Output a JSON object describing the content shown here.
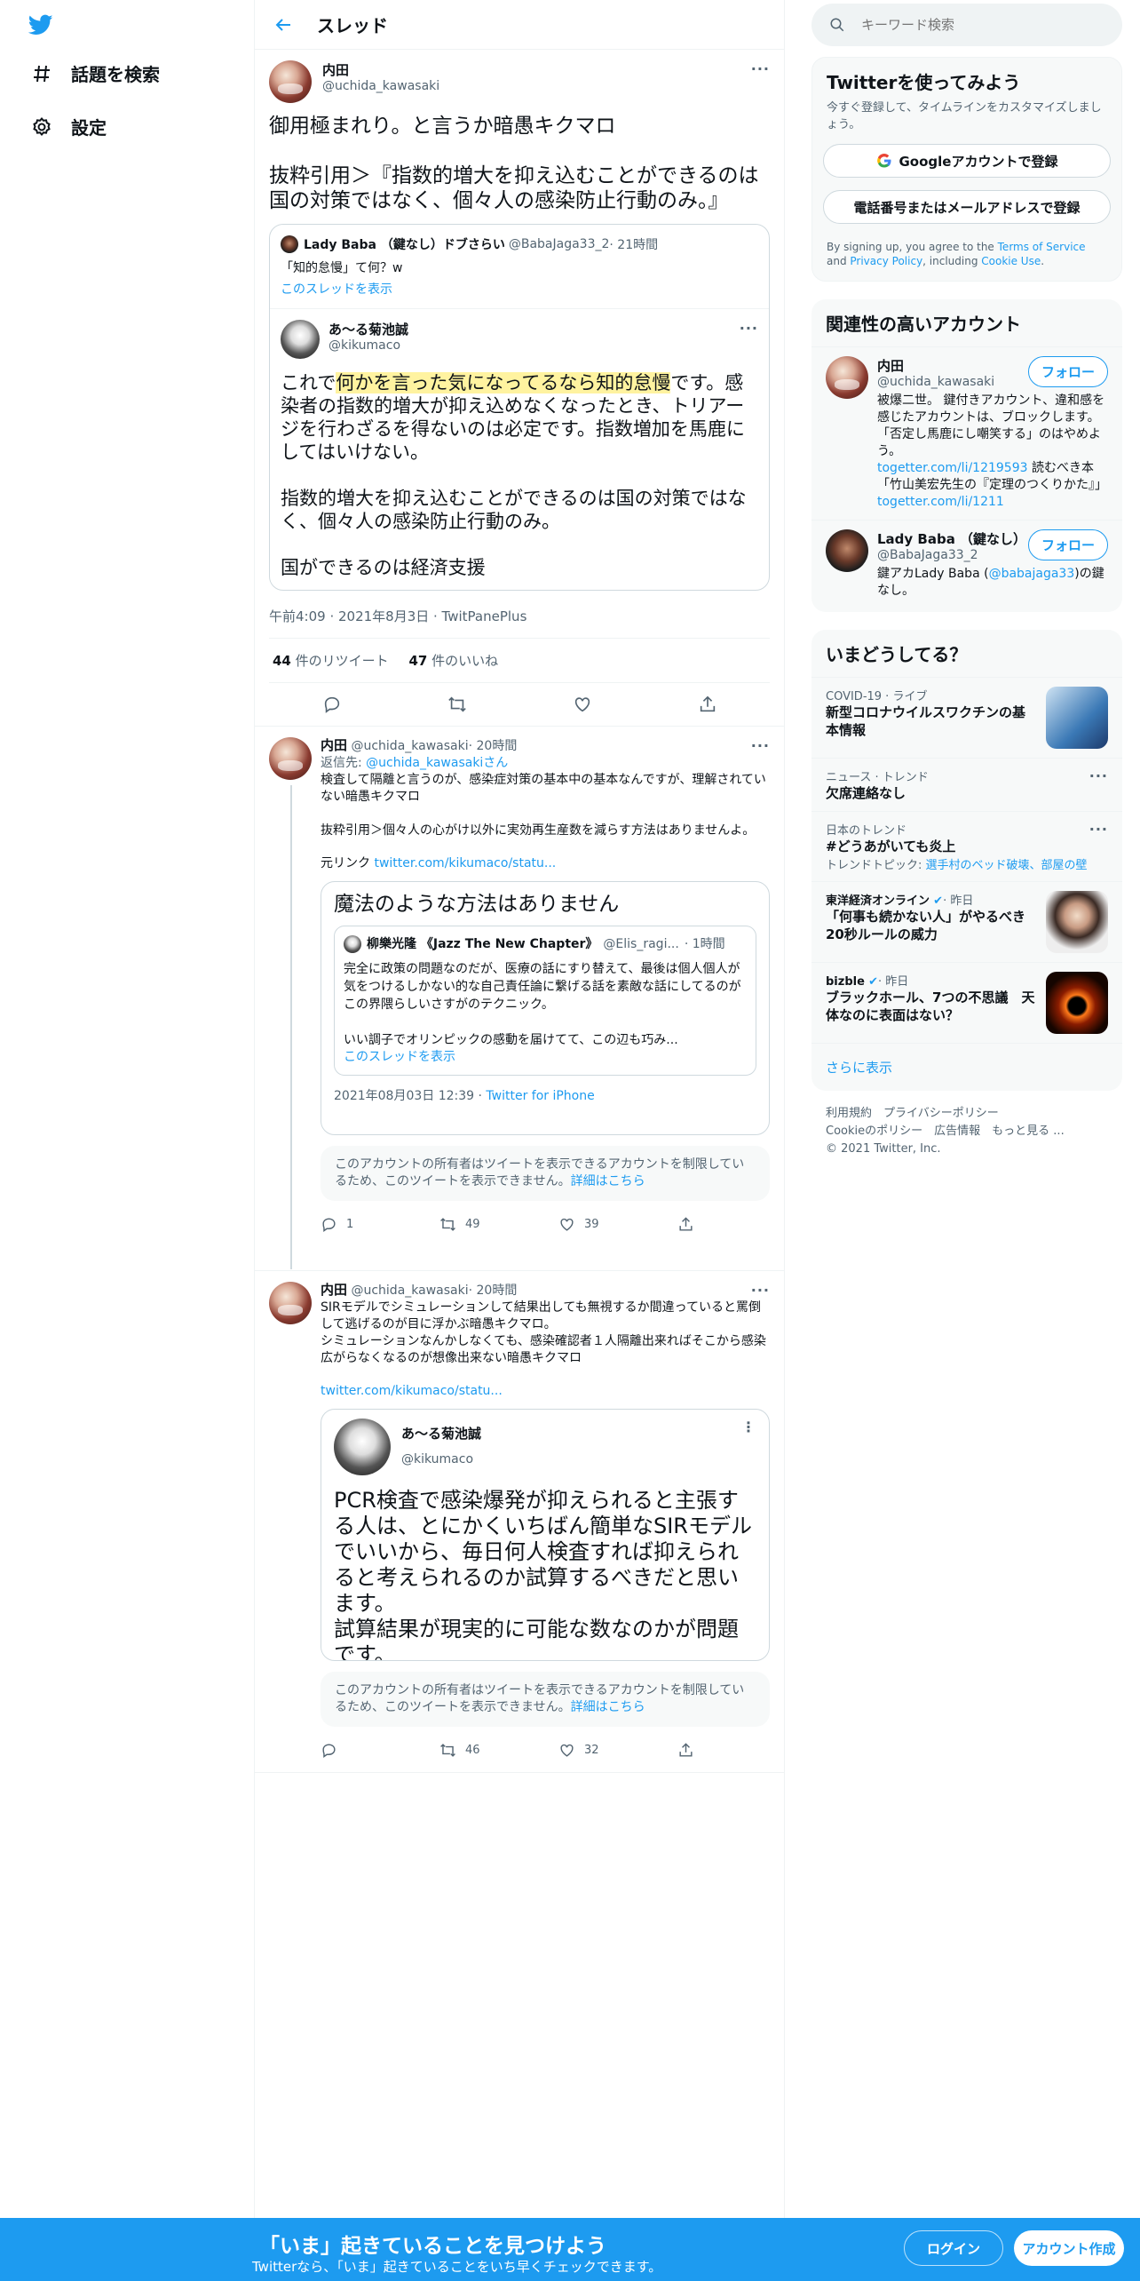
{
  "header": {
    "title": "スレッド"
  },
  "nav": {
    "explore": "話題を検索",
    "settings": "設定"
  },
  "main": {
    "name": "内田",
    "handle": "@uchida_kawasaki",
    "text": "御用極まれり。と言うか暗愚キクマロ\n\n抜粋引用＞『指数的増大を抑え込むことができるのは国の対策ではなく、個々人の感染防止行動のみ。』",
    "quote": {
      "top_name": "Lady Baba （鍵なし）ドブさらい",
      "top_handle": "@BabaJaga33_2",
      "top_time": "· 21時間",
      "top_text": "「知的怠慢」て何？w",
      "top_link": "このスレッドを表示",
      "name": "あ〜る菊池誠",
      "handle": "@kikumaco",
      "text_a": "これで",
      "text_hl": "何かを言った気になってるなら知的怠慢",
      "text_b": "です。感染者の指数的増大が抑え込めなくなったとき、トリアージを行わざるを得ないのは必定です。指数増加を馬鹿にしてはいけない。\n\n指数的増大を抑え込むことができるのは国の対策ではなく、個々人の感染防止行動のみ。\n\n国ができるのは経済支援"
    },
    "meta": "午前4:09 · 2021年8月3日 · TwitPanePlus",
    "retweets": "44",
    "retweets_label": "件のリツイート",
    "likes": "47",
    "likes_label": "件のいいね"
  },
  "reply1": {
    "name": "内田",
    "handle": "@uchida_kawasaki",
    "time": "· 20時間",
    "reply_to_label": "返信先: ",
    "reply_to": "@uchida_kawasakiさん",
    "text": "検査して隔離と言うのが、感染症対策の基本中の基本なんですが、理解されていない暗愚キクマロ\n\n抜粋引用＞個々人の心がけ以外に実効再生産数を減らす方法はありませんよ。",
    "link_label": "元リンク ",
    "link": "twitter.com/kikumaco/statu...",
    "card": {
      "title": "魔法のような方法はありません",
      "q_name": "柳樂光隆 《Jazz The New Chapter》",
      "q_handle": "@Elis_ragi...",
      "q_time": "· 1時間",
      "q_text": "完全に政策の問題なのだが、医療の話にすり替えて、最後は個人個人が気をつけるしかない的な自己責任論に繋げる話を素敵な話にしてるのがこの界隈らしいさすがのテクニック。\n\nいい調子でオリンピックの感動を届けてて、この辺も巧み...",
      "q_link": "このスレッドを表示",
      "date": "2021年08月03日 12:39 · ",
      "source": "Twitter for iPhone"
    },
    "notice": "このアカウントの所有者はツイートを表示できるアカウントを制限しているため、このツイートを表示できません。",
    "notice_link": "詳細はこちら",
    "replies": "1",
    "retweets": "49",
    "likes": "39"
  },
  "reply2": {
    "name": "内田",
    "handle": "@uchida_kawasaki",
    "time": "· 20時間",
    "text": "SIRモデルでシミュレーションして結果出しても無視するか間違っていると罵倒して逃げるのが目に浮かぶ暗愚キクマロ。\nシミュレーションなんかしなくても、感染確認者１人隔離出来ればそこから感染広がらなくなるのが想像出来ない暗愚キクマロ",
    "link": "twitter.com/kikumaco/statu...",
    "quote": {
      "name": "あ〜る菊池誠",
      "handle": "@kikumaco",
      "text": "PCR検査で感染爆発が抑えられると主張する人は、とにかくいちばん簡単なSIRモデルでいいから、毎日何人検査すれば抑えられると考えられるのか試算するべきだと思います。\n試算結果が現実的に可能な数なのかが問題です。\nこればっかりは試算なしに議論できない"
    },
    "notice": "このアカウントの所有者はツイートを表示できるアカウントを制限しているため、このツイートを表示できません。",
    "notice_link": "詳細はこちら",
    "retweets": "46",
    "likes": "32"
  },
  "right": {
    "search_placeholder": "キーワード検索",
    "signup": {
      "title": "Twitterを使ってみよう",
      "sub": "今すぐ登録して、タイムラインをカスタマイズしましょう。",
      "google": "Googleアカウントで登録",
      "phone": "電話番号またはメールアドレスで登録",
      "legal_a": "By signing up, you agree to the ",
      "terms": "Terms of Service",
      "legal_b": " and ",
      "privacy": "Privacy Policy",
      "legal_c": ", including ",
      "cookie": "Cookie Use",
      "legal_d": "."
    },
    "related": {
      "title": "関連性の高いアカウント",
      "follow": "フォロー",
      "a1": {
        "name": "内田",
        "handle": "@uchida_kawasaki",
        "bio_a": "被爆二世。 鍵付きアカウント、違和感を感じたアカウントは、ブロックします。「否定し馬鹿にし嘲笑する」のはやめよう。\n",
        "bio_link1": "togetter.com/li/1219593",
        "bio_b": " 読むべき本「竹山美宏先生の『定理のつくりかた』」 ",
        "bio_link2": "togetter.com/li/1211"
      },
      "a2": {
        "name": "Lady Baba （鍵なし）",
        "handle": "@BabaJaga33_2",
        "bio_a": "鍵アカLady Baba (",
        "bio_link": "@babajaga33",
        "bio_b": ")の鍵なし。"
      }
    },
    "trends": {
      "title": "いまどうしてる？",
      "t1": {
        "cat": "COVID-19 · ライブ",
        "title": "新型コロナウイルスワクチンの基本情報"
      },
      "t2": {
        "cat": "ニュース · トレンド",
        "title": "欠席連絡なし"
      },
      "t3": {
        "cat": "日本のトレンド",
        "title": "#どうあがいても炎上",
        "sub_label": "トレンドトピック: ",
        "sub": "選手村のベッド破壊、部屋の壁"
      },
      "t4": {
        "cat": "東洋経済オンライン",
        "time": "· 昨日",
        "title": "「何事も続かない人」がやるべき20秒ルールの威力"
      },
      "t5": {
        "cat": "bizble",
        "time": "· 昨日",
        "title": "ブラックホール、7つの不思議　天体なのに表面はない？"
      },
      "more": "さらに表示"
    },
    "footer": {
      "l1": "利用規約",
      "l2": "プライバシーポリシー",
      "l3": "Cookieのポリシー",
      "l4": "広告情報",
      "l5": "もっと見る ...",
      "copy": "© 2021 Twitter, Inc."
    }
  },
  "bottom": {
    "title": "「いま」起きていることを見つけよう",
    "sub": "Twitterなら、「いま」起きていることをいち早くチェックできます。",
    "login": "ログイン",
    "signup": "アカウント作成"
  },
  "colors": {
    "accent": "#1d9bf0",
    "text": "#0f1419",
    "muted": "#536471",
    "highlight": "#fff3a0"
  }
}
